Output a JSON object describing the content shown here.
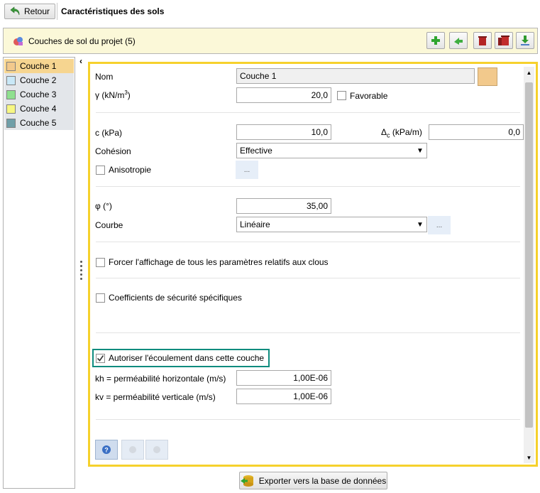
{
  "header": {
    "back_label": "Retour",
    "title": "Caractéristiques des sols"
  },
  "project_bar": {
    "label": "Couches de sol du projet (5)"
  },
  "layers": [
    {
      "label": "Couche 1",
      "color": "#f2c98c",
      "selected": true
    },
    {
      "label": "Couche 2",
      "color": "#c9e8f7",
      "selected": false
    },
    {
      "label": "Couche 3",
      "color": "#8fe08f",
      "selected": false
    },
    {
      "label": "Couche 4",
      "color": "#f7f783",
      "selected": false
    },
    {
      "label": "Couche 5",
      "color": "#6f9fa8",
      "selected": false
    }
  ],
  "form": {
    "nom_label": "Nom",
    "nom_value": "Couche 1",
    "gamma_label": "γ (kN/m",
    "gamma_sup": "3",
    "gamma_close": ")",
    "gamma_value": "20,0",
    "favorable_label": "Favorable",
    "c_label": "c (kPa)",
    "c_value": "10,0",
    "delta_label": "Δ",
    "delta_sub": "c",
    "delta_unit": " (kPa/m)",
    "delta_value": "0,0",
    "cohesion_label": "Cohésion",
    "cohesion_value": "Effective",
    "anisotropie_label": "Anisotropie",
    "phi_label": "φ (°)",
    "phi_value": "35,00",
    "courbe_label": "Courbe",
    "courbe_value": "Linéaire",
    "ellipsis": "...",
    "clous_label": "Forcer l'affichage de tous les paramètres relatifs aux clous",
    "coef_label": "Coefficients de sécurité spécifiques",
    "ecoulement_label": "Autoriser l'écoulement dans cette couche",
    "kh_label": "kh = perméabilité horizontale (m/s)",
    "kh_value": "1,00E-06",
    "kv_label": "kv = perméabilité verticale (m/s)",
    "kv_value": "1,00E-06"
  },
  "footer": {
    "export_label": "Exporter vers la base de données"
  },
  "colors": {
    "panel_border": "#f6d12c",
    "highlight_border": "#0e8c7e",
    "selected_layer": "#f6d590",
    "project_bar_bg": "#fbf8d8"
  }
}
